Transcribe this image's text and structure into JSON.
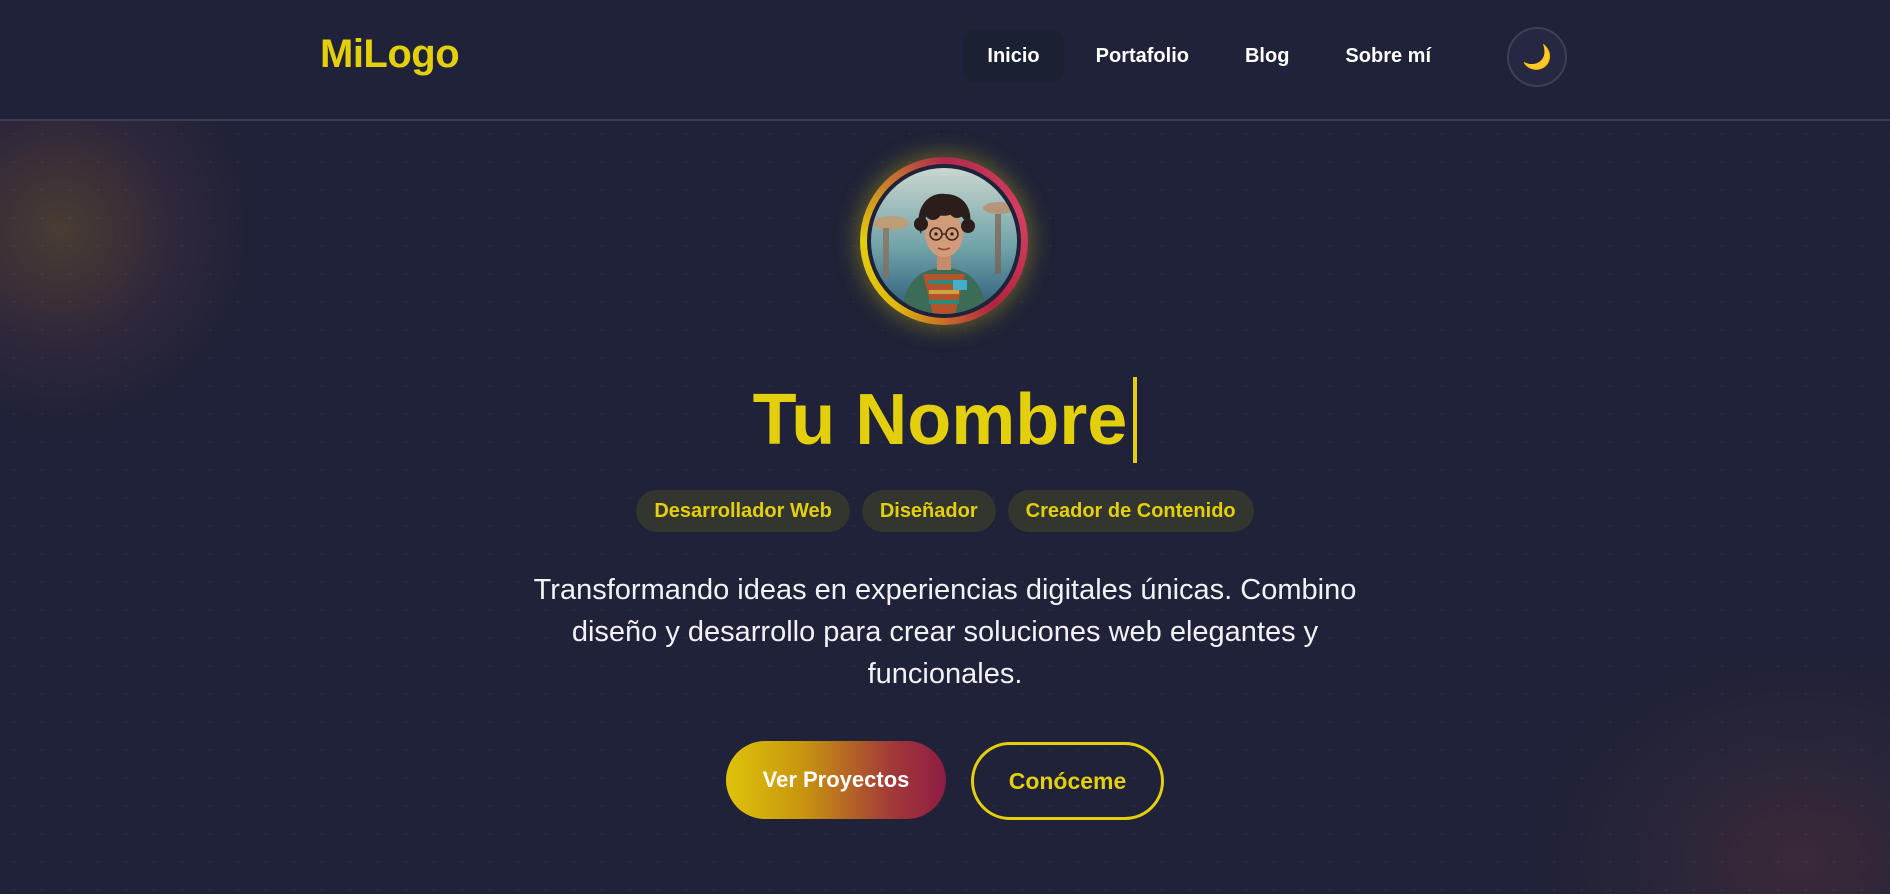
{
  "header": {
    "logo": "MiLogo",
    "nav": [
      {
        "label": "Inicio",
        "active": true
      },
      {
        "label": "Portafolio",
        "active": false
      },
      {
        "label": "Blog",
        "active": false
      },
      {
        "label": "Sobre mí",
        "active": false
      }
    ],
    "theme_toggle_icon": "🌙"
  },
  "hero": {
    "avatar_icon": "profile-portrait",
    "name": "Tu Nombre",
    "tags": [
      "Desarrollador Web",
      "Diseñador",
      "Creador de Contenido"
    ],
    "description": "Transformando ideas en experiencias digitales únicas. Combino diseño y desarrollo para crear soluciones web elegantes y funcionales.",
    "primary_cta": "Ver Proyectos",
    "secondary_cta": "Conóceme"
  },
  "colors": {
    "background": "#1f2238",
    "accent": "#e3cf0b",
    "secondary_accent": "#8e1c44"
  }
}
